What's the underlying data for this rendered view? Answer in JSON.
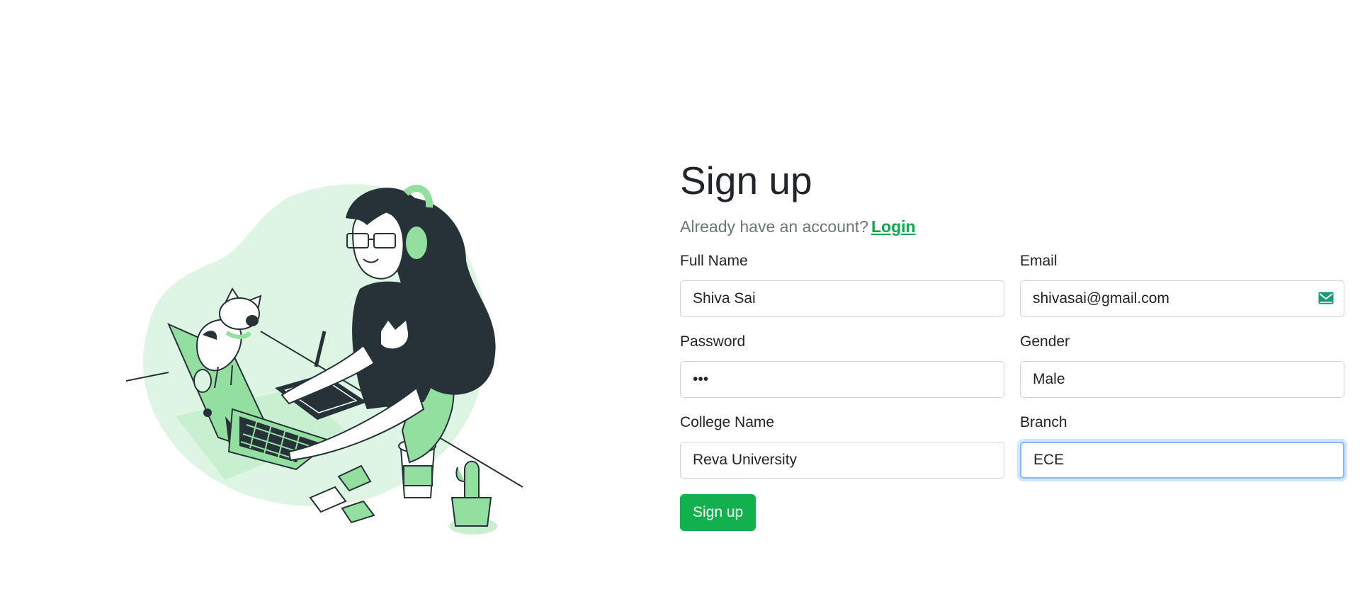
{
  "header": {
    "title": "Sign up",
    "subtitle": "Already have an account?",
    "login_link": "Login"
  },
  "form": {
    "full_name": {
      "label": "Full Name",
      "value": "Shiva Sai"
    },
    "email": {
      "label": "Email",
      "value": "shivasai@gmail.com",
      "icon": "mail-icon"
    },
    "password": {
      "label": "Password",
      "value": "•••"
    },
    "gender": {
      "label": "Gender",
      "value": "Male"
    },
    "college": {
      "label": "College Name",
      "value": "Reva University"
    },
    "branch": {
      "label": "Branch",
      "value": "ECE"
    },
    "submit_label": "Sign up"
  },
  "colors": {
    "accent": "#12b14d",
    "link": "#0fa84d",
    "illustration_light": "#dff5e4",
    "illustration_mid": "#93df9f",
    "illustration_dark": "#263238"
  }
}
